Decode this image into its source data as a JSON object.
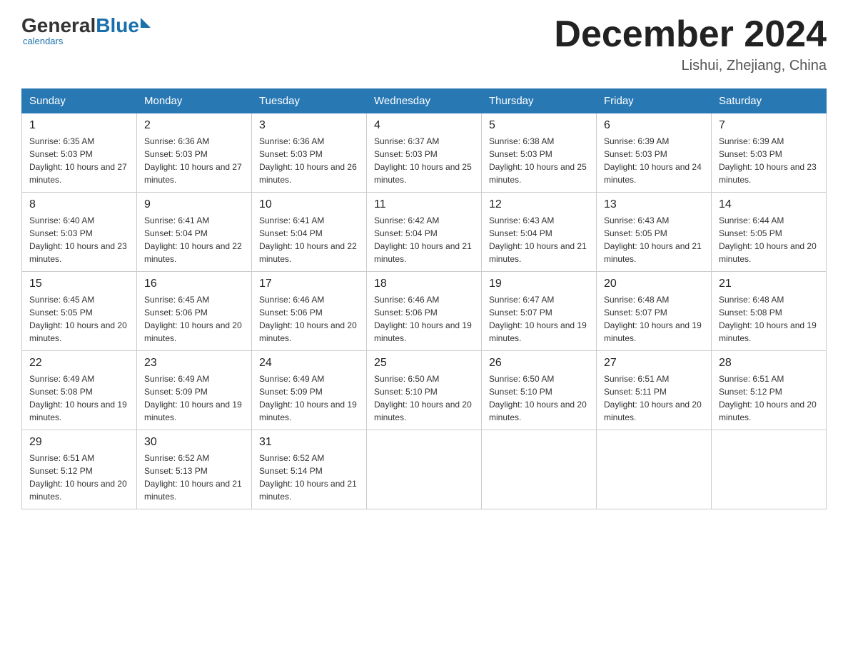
{
  "header": {
    "logo_general": "General",
    "logo_blue": "Blue",
    "month_title": "December 2024",
    "location": "Lishui, Zhejiang, China"
  },
  "days_of_week": [
    "Sunday",
    "Monday",
    "Tuesday",
    "Wednesday",
    "Thursday",
    "Friday",
    "Saturday"
  ],
  "weeks": [
    [
      {
        "day": "1",
        "sunrise": "6:35 AM",
        "sunset": "5:03 PM",
        "daylight": "10 hours and 27 minutes."
      },
      {
        "day": "2",
        "sunrise": "6:36 AM",
        "sunset": "5:03 PM",
        "daylight": "10 hours and 27 minutes."
      },
      {
        "day": "3",
        "sunrise": "6:36 AM",
        "sunset": "5:03 PM",
        "daylight": "10 hours and 26 minutes."
      },
      {
        "day": "4",
        "sunrise": "6:37 AM",
        "sunset": "5:03 PM",
        "daylight": "10 hours and 25 minutes."
      },
      {
        "day": "5",
        "sunrise": "6:38 AM",
        "sunset": "5:03 PM",
        "daylight": "10 hours and 25 minutes."
      },
      {
        "day": "6",
        "sunrise": "6:39 AM",
        "sunset": "5:03 PM",
        "daylight": "10 hours and 24 minutes."
      },
      {
        "day": "7",
        "sunrise": "6:39 AM",
        "sunset": "5:03 PM",
        "daylight": "10 hours and 23 minutes."
      }
    ],
    [
      {
        "day": "8",
        "sunrise": "6:40 AM",
        "sunset": "5:03 PM",
        "daylight": "10 hours and 23 minutes."
      },
      {
        "day": "9",
        "sunrise": "6:41 AM",
        "sunset": "5:04 PM",
        "daylight": "10 hours and 22 minutes."
      },
      {
        "day": "10",
        "sunrise": "6:41 AM",
        "sunset": "5:04 PM",
        "daylight": "10 hours and 22 minutes."
      },
      {
        "day": "11",
        "sunrise": "6:42 AM",
        "sunset": "5:04 PM",
        "daylight": "10 hours and 21 minutes."
      },
      {
        "day": "12",
        "sunrise": "6:43 AM",
        "sunset": "5:04 PM",
        "daylight": "10 hours and 21 minutes."
      },
      {
        "day": "13",
        "sunrise": "6:43 AM",
        "sunset": "5:05 PM",
        "daylight": "10 hours and 21 minutes."
      },
      {
        "day": "14",
        "sunrise": "6:44 AM",
        "sunset": "5:05 PM",
        "daylight": "10 hours and 20 minutes."
      }
    ],
    [
      {
        "day": "15",
        "sunrise": "6:45 AM",
        "sunset": "5:05 PM",
        "daylight": "10 hours and 20 minutes."
      },
      {
        "day": "16",
        "sunrise": "6:45 AM",
        "sunset": "5:06 PM",
        "daylight": "10 hours and 20 minutes."
      },
      {
        "day": "17",
        "sunrise": "6:46 AM",
        "sunset": "5:06 PM",
        "daylight": "10 hours and 20 minutes."
      },
      {
        "day": "18",
        "sunrise": "6:46 AM",
        "sunset": "5:06 PM",
        "daylight": "10 hours and 19 minutes."
      },
      {
        "day": "19",
        "sunrise": "6:47 AM",
        "sunset": "5:07 PM",
        "daylight": "10 hours and 19 minutes."
      },
      {
        "day": "20",
        "sunrise": "6:48 AM",
        "sunset": "5:07 PM",
        "daylight": "10 hours and 19 minutes."
      },
      {
        "day": "21",
        "sunrise": "6:48 AM",
        "sunset": "5:08 PM",
        "daylight": "10 hours and 19 minutes."
      }
    ],
    [
      {
        "day": "22",
        "sunrise": "6:49 AM",
        "sunset": "5:08 PM",
        "daylight": "10 hours and 19 minutes."
      },
      {
        "day": "23",
        "sunrise": "6:49 AM",
        "sunset": "5:09 PM",
        "daylight": "10 hours and 19 minutes."
      },
      {
        "day": "24",
        "sunrise": "6:49 AM",
        "sunset": "5:09 PM",
        "daylight": "10 hours and 19 minutes."
      },
      {
        "day": "25",
        "sunrise": "6:50 AM",
        "sunset": "5:10 PM",
        "daylight": "10 hours and 20 minutes."
      },
      {
        "day": "26",
        "sunrise": "6:50 AM",
        "sunset": "5:10 PM",
        "daylight": "10 hours and 20 minutes."
      },
      {
        "day": "27",
        "sunrise": "6:51 AM",
        "sunset": "5:11 PM",
        "daylight": "10 hours and 20 minutes."
      },
      {
        "day": "28",
        "sunrise": "6:51 AM",
        "sunset": "5:12 PM",
        "daylight": "10 hours and 20 minutes."
      }
    ],
    [
      {
        "day": "29",
        "sunrise": "6:51 AM",
        "sunset": "5:12 PM",
        "daylight": "10 hours and 20 minutes."
      },
      {
        "day": "30",
        "sunrise": "6:52 AM",
        "sunset": "5:13 PM",
        "daylight": "10 hours and 21 minutes."
      },
      {
        "day": "31",
        "sunrise": "6:52 AM",
        "sunset": "5:14 PM",
        "daylight": "10 hours and 21 minutes."
      },
      null,
      null,
      null,
      null
    ]
  ]
}
